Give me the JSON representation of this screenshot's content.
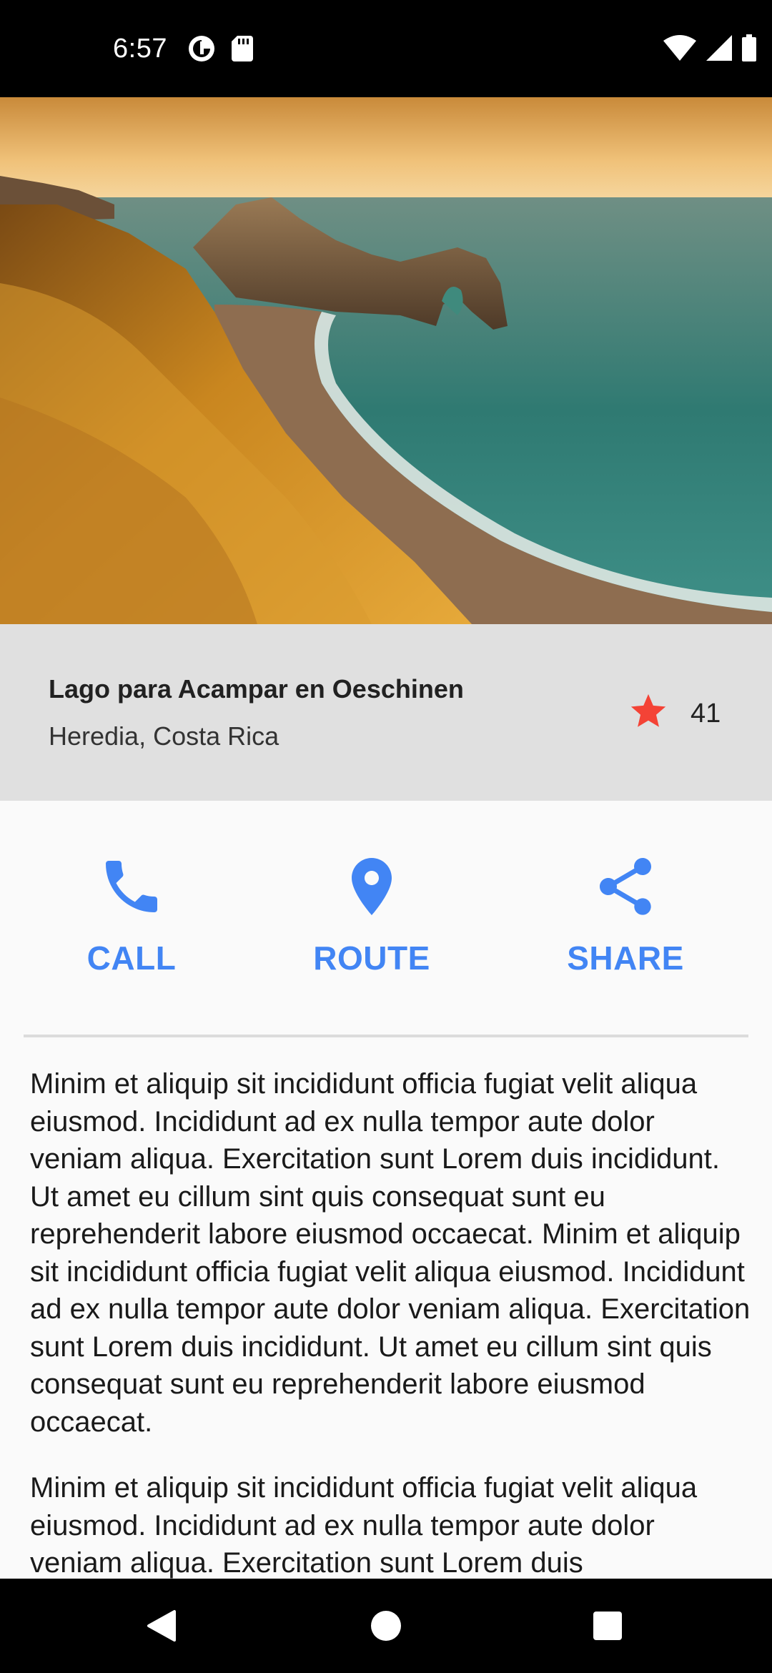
{
  "status_bar": {
    "time": "6:57",
    "left_icons": [
      "data-saver-icon",
      "sd-card-icon"
    ],
    "right_icons": [
      "wifi-icon",
      "signal-icon",
      "battery-icon"
    ]
  },
  "hero": {
    "image": "coastal-arch-landscape"
  },
  "place": {
    "name": "Lago para Acampar en Oeschinen",
    "location": "Heredia, Costa Rica",
    "star_count": "41",
    "star_color": "#f44336"
  },
  "actions": [
    {
      "label": "CALL",
      "icon": "phone-icon"
    },
    {
      "label": "ROUTE",
      "icon": "location-pin-icon"
    },
    {
      "label": "SHARE",
      "icon": "share-icon"
    }
  ],
  "accent_color": "#4285f4",
  "description": {
    "paragraphs": [
      "Minim et aliquip sit incididunt officia fugiat velit aliqua eiusmod. Incididunt ad ex nulla tempor aute dolor veniam aliqua. Exercitation sunt Lorem duis incididunt. Ut amet eu cillum sint quis consequat sunt eu reprehenderit labore eiusmod occaecat. Minim et aliquip sit incididunt officia fugiat velit aliqua eiusmod. Incididunt ad ex nulla tempor aute dolor veniam aliqua. Exercitation sunt Lorem duis incididunt. Ut amet eu cillum sint quis consequat sunt eu reprehenderit labore eiusmod occaecat.",
      "Minim et aliquip sit incididunt officia fugiat velit aliqua eiusmod. Incididunt ad ex nulla tempor aute dolor veniam aliqua. Exercitation sunt Lorem duis"
    ]
  },
  "nav_bar": {
    "buttons": [
      "back-icon",
      "home-icon",
      "recents-icon"
    ]
  }
}
